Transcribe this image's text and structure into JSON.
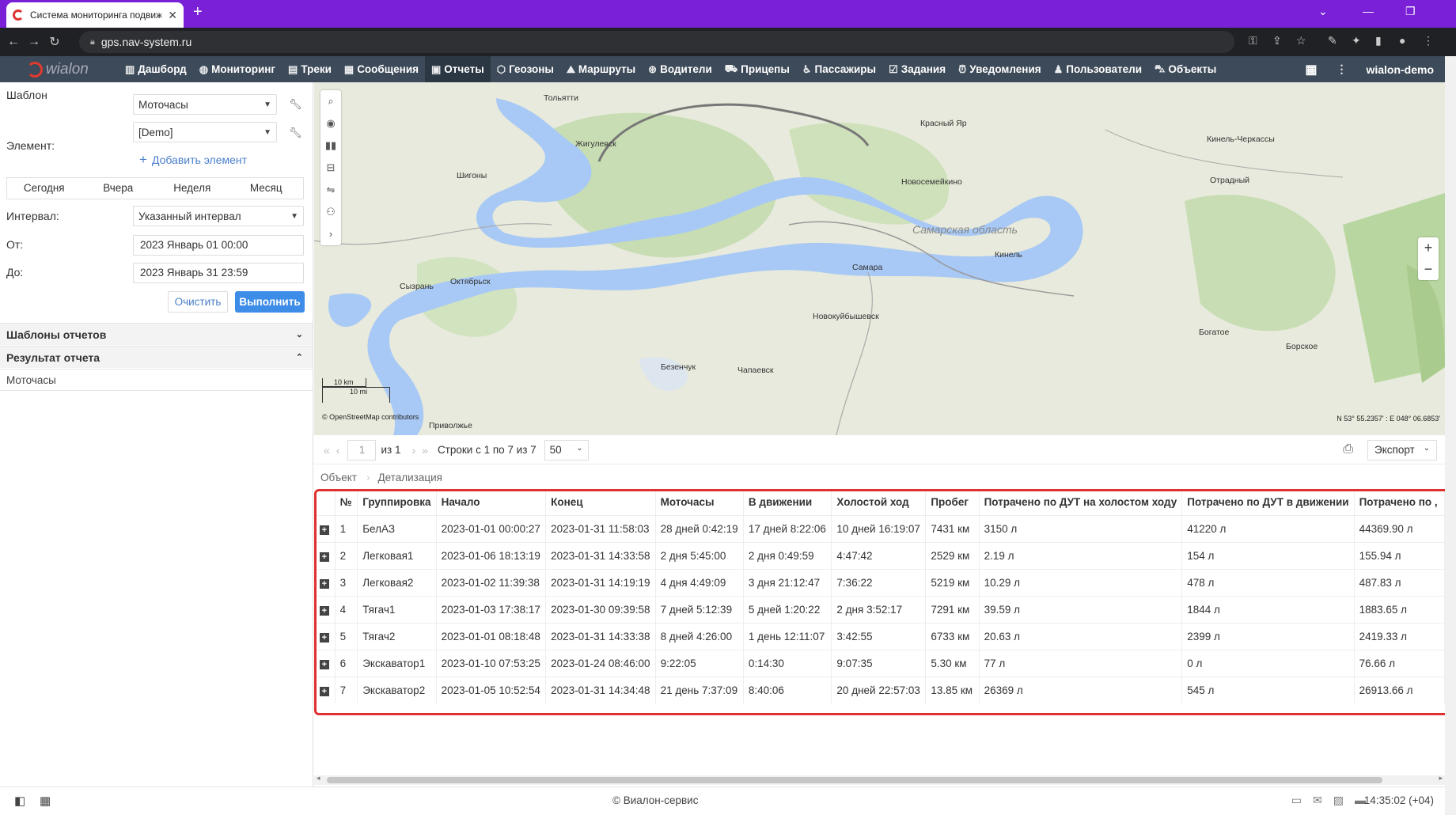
{
  "browser": {
    "tab_title": "Система мониторинга подвижн",
    "url": "gps.nav-system.ru"
  },
  "appnav": {
    "logo": "wialon",
    "items": [
      {
        "label": "Дашборд",
        "icon": "bar-chart-icon"
      },
      {
        "label": "Мониторинг",
        "icon": "globe-icon"
      },
      {
        "label": "Треки",
        "icon": "track-icon"
      },
      {
        "label": "Сообщения",
        "icon": "message-icon"
      },
      {
        "label": "Отчеты",
        "icon": "report-icon",
        "active": true
      },
      {
        "label": "Геозоны",
        "icon": "geofence-icon"
      },
      {
        "label": "Маршруты",
        "icon": "route-icon"
      },
      {
        "label": "Водители",
        "icon": "steering-icon"
      },
      {
        "label": "Прицепы",
        "icon": "trailer-icon"
      },
      {
        "label": "Пассажиры",
        "icon": "passenger-icon"
      },
      {
        "label": "Задания",
        "icon": "task-icon"
      },
      {
        "label": "Уведомления",
        "icon": "alarm-icon"
      },
      {
        "label": "Пользователи",
        "icon": "user-icon"
      },
      {
        "label": "Объекты",
        "icon": "vehicle-icon"
      }
    ],
    "user": "wialon-demo"
  },
  "left": {
    "template_label": "Шаблон",
    "template_value": "Моточасы",
    "element_label": "Элемент:",
    "element_value": "[Demo]",
    "add_element": "Добавить элемент",
    "periods": [
      "Сегодня",
      "Вчера",
      "Неделя",
      "Месяц"
    ],
    "interval_label": "Интервал:",
    "interval_value": "Указанный интервал",
    "from_label": "От:",
    "from_value": "2023 Январь 01 00:00",
    "to_label": "До:",
    "to_value": "2023 Январь 31 23:59",
    "clear_button": "Очистить",
    "run_button": "Выполнить",
    "report_templates": "Шаблоны отчетов",
    "report_result": "Результат отчета",
    "result_item": "Моточасы"
  },
  "map": {
    "cities": [
      "Тольятти",
      "Жигулевск",
      "Красный Яр",
      "Кинель-Черкассы",
      "Шигоны",
      "Новосемейкино",
      "Отрадный",
      "Кинель",
      "Самара",
      "Сызрань",
      "Октябрьск",
      "Новокуйбышевск",
      "Богатое",
      "Борское",
      "Безенчук",
      "Чапаевск",
      "Приволжье"
    ],
    "region": "Самарская область",
    "scale_km": "10 km",
    "scale_mi": "10 mi",
    "attribution": "© OpenStreetMap contributors",
    "coords": "N 53° 55.2357' : E 048° 06.6853'"
  },
  "pager": {
    "page": "1",
    "of": "из 1",
    "rows_info": "Строки с 1 по 7 из 7",
    "page_size": "50",
    "export": "Экспорт"
  },
  "crumbs": [
    "Объект",
    "Детализация"
  ],
  "table": {
    "headers": [
      "",
      "№",
      "Группировка",
      "Начало",
      "Конец",
      "Моточасы",
      "В движении",
      "Холостой ход",
      "Пробег",
      "Потрачено по ДУТ на холостом ходу",
      "Потрачено по ДУТ в движении",
      "Потрачено по ,"
    ],
    "rows": [
      [
        "1",
        "БелАЗ",
        "2023-01-01 00:00:27",
        "2023-01-31 11:58:03",
        "28 дней 0:42:19",
        "17 дней 8:22:06",
        "10 дней 16:19:07",
        "7431 км",
        "3150 л",
        "41220 л",
        "44369.90 л"
      ],
      [
        "2",
        "Легковая1",
        "2023-01-06 18:13:19",
        "2023-01-31 14:33:58",
        "2 дня 5:45:00",
        "2 дня 0:49:59",
        "4:47:42",
        "2529 км",
        "2.19 л",
        "154 л",
        "155.94 л"
      ],
      [
        "3",
        "Легковая2",
        "2023-01-02 11:39:38",
        "2023-01-31 14:19:19",
        "4 дня 4:49:09",
        "3 дня 21:12:47",
        "7:36:22",
        "5219 км",
        "10.29 л",
        "478 л",
        "487.83 л"
      ],
      [
        "4",
        "Тягач1",
        "2023-01-03 17:38:17",
        "2023-01-30 09:39:58",
        "7 дней 5:12:39",
        "5 дней 1:20:22",
        "2 дня 3:52:17",
        "7291 км",
        "39.59 л",
        "1844 л",
        "1883.65 л"
      ],
      [
        "5",
        "Тягач2",
        "2023-01-01 08:18:48",
        "2023-01-31 14:33:38",
        "8 дней 4:26:00",
        "1 день 12:11:07",
        "3:42:55",
        "6733 км",
        "20.63 л",
        "2399 л",
        "2419.33 л"
      ],
      [
        "6",
        "Экскаватор1",
        "2023-01-10 07:53:25",
        "2023-01-24 08:46:00",
        "9:22:05",
        "0:14:30",
        "9:07:35",
        "5.30 км",
        "77 л",
        "0 л",
        "76.66 л"
      ],
      [
        "7",
        "Экскаватор2",
        "2023-01-05 10:52:54",
        "2023-01-31 14:34:48",
        "21 день 7:37:09",
        "8:40:06",
        "20 дней 22:57:03",
        "13.85 км",
        "26369 л",
        "545 л",
        "26913.66 л"
      ]
    ]
  },
  "footer": {
    "copyright": "© Виалон-сервис",
    "time": "14:35:02 (+04)"
  }
}
